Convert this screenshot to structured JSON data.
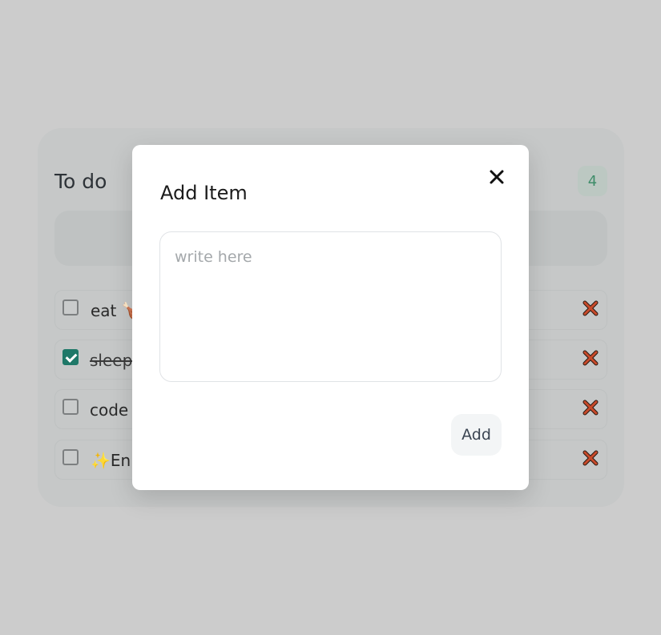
{
  "todo": {
    "title": "To do",
    "count": "4",
    "items": [
      {
        "label": "eat 🍗",
        "checked": false
      },
      {
        "label": "sleep",
        "checked": true
      },
      {
        "label": "code",
        "checked": false
      },
      {
        "label": "✨En",
        "checked": false
      }
    ]
  },
  "modal": {
    "title": "Add Item",
    "textarea_placeholder": "write here",
    "textarea_value": "",
    "add_label": "Add",
    "close_icon": "close-icon"
  },
  "colors": {
    "overlay": "#cccccc",
    "checked": "#1f7868",
    "delete": "#c0392b",
    "count_text": "#3f8d6a"
  }
}
